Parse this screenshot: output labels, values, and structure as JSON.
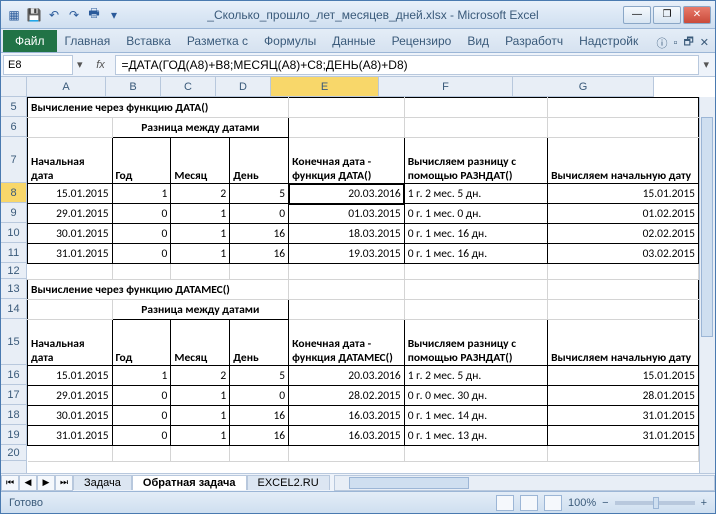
{
  "title": "_Сколько_прошло_лет_месяцев_дней.xlsx - Microsoft Excel",
  "ribbon": {
    "file": "Файл",
    "tabs": [
      "Главная",
      "Вставка",
      "Разметка с",
      "Формулы",
      "Данные",
      "Рецензиро",
      "Вид",
      "Разработч",
      "Надстройк"
    ]
  },
  "formula_bar": {
    "name_box": "E8",
    "formula": "=ДАТА(ГОД(A8)+B8;МЕСЯЦ(A8)+C8;ДЕНЬ(A8)+D8)"
  },
  "cols": [
    "A",
    "B",
    "C",
    "D",
    "E",
    "F",
    "G"
  ],
  "rows": [
    "5",
    "6",
    "7",
    "8",
    "9",
    "10",
    "11",
    "12",
    "13",
    "14",
    "15",
    "16",
    "17",
    "18",
    "19",
    "20"
  ],
  "section1": {
    "title": "Вычисление через функцию ДАТА()",
    "diff_header": "Разница между датами",
    "headers": {
      "start": "Начальная дата",
      "year": "Год",
      "month": "Месяц",
      "day": "День",
      "end": "Конечная дата - функция ДАТА()",
      "razndat": "Вычисляем разницу с помощью РАЗНДАТ()",
      "back": "Вычисляем начальную дату"
    },
    "data": [
      {
        "a": "15.01.2015",
        "b": "1",
        "c": "2",
        "d": "5",
        "e": "20.03.2016",
        "f": "1 г. 2 мес. 5 дн.",
        "g": "15.01.2015"
      },
      {
        "a": "29.01.2015",
        "b": "0",
        "c": "1",
        "d": "0",
        "e": "01.03.2015",
        "f": "0 г. 1 мес. 0 дн.",
        "g": "01.02.2015"
      },
      {
        "a": "30.01.2015",
        "b": "0",
        "c": "1",
        "d": "16",
        "e": "18.03.2015",
        "f": "0 г. 1 мес. 16 дн.",
        "g": "02.02.2015"
      },
      {
        "a": "31.01.2015",
        "b": "0",
        "c": "1",
        "d": "16",
        "e": "19.03.2015",
        "f": "0 г. 1 мес. 16 дн.",
        "g": "03.02.2015"
      }
    ]
  },
  "section2": {
    "title": "Вычисление через функцию ДАТАМЕС()",
    "diff_header": "Разница между датами",
    "headers": {
      "start": "Начальная дата",
      "year": "Год",
      "month": "Месяц",
      "day": "День",
      "end": "Конечная дата - функция ДАТАМЕС()",
      "razndat": "Вычисляем разницу с помощью РАЗНДАТ()",
      "back": "Вычисляем начальную дату"
    },
    "data": [
      {
        "a": "15.01.2015",
        "b": "1",
        "c": "2",
        "d": "5",
        "e": "20.03.2016",
        "f": "1 г. 2 мес. 5 дн.",
        "g": "15.01.2015"
      },
      {
        "a": "29.01.2015",
        "b": "0",
        "c": "1",
        "d": "0",
        "e": "28.02.2015",
        "f": "0 г. 0 мес. 30 дн.",
        "g": "28.01.2015"
      },
      {
        "a": "30.01.2015",
        "b": "0",
        "c": "1",
        "d": "16",
        "e": "16.03.2015",
        "f": "0 г. 1 мес. 14 дн.",
        "g": "31.01.2015"
      },
      {
        "a": "31.01.2015",
        "b": "0",
        "c": "1",
        "d": "16",
        "e": "16.03.2015",
        "f": "0 г. 1 мес. 13 дн.",
        "g": "31.01.2015"
      }
    ]
  },
  "sheets": {
    "tabs": [
      "Задача",
      "Обратная задача",
      "EXCEL2.RU"
    ],
    "active": 1
  },
  "status": {
    "ready": "Готово",
    "zoom": "100%",
    "minus": "−",
    "plus": "+"
  }
}
